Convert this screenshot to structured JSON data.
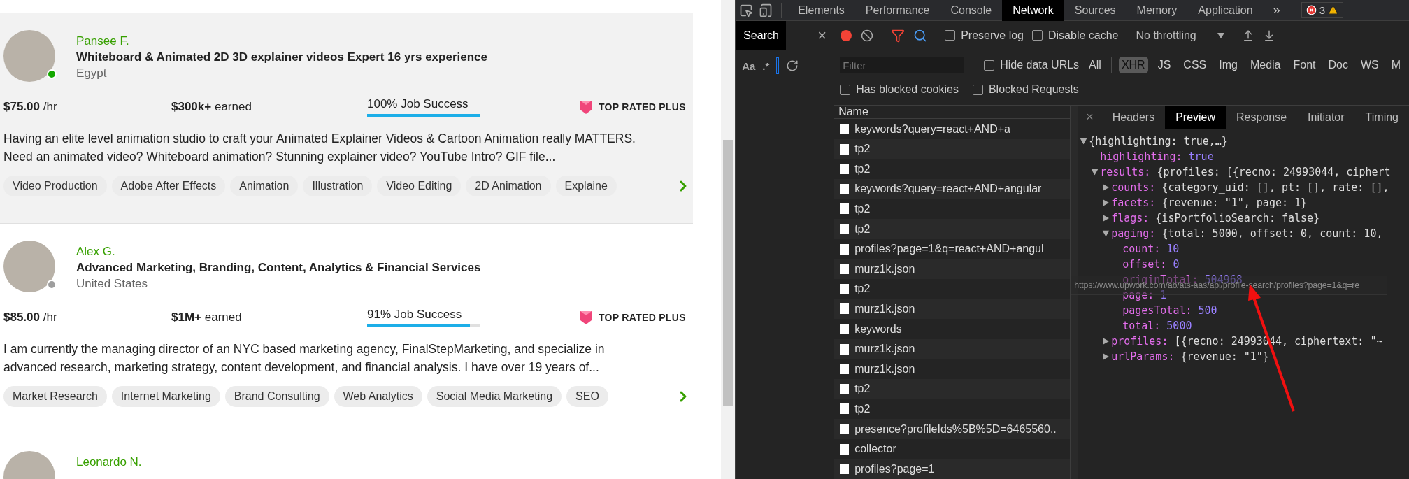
{
  "profiles": [
    {
      "name": "Pansee F.",
      "title": "Whiteboard & Animated 2D 3D explainer videos Expert 16 yrs experience",
      "country": "Egypt",
      "online": true,
      "highlighted": true,
      "rate": "$75.00",
      "rate_unit": "/hr",
      "earned": "$300k+",
      "earned_label": "earned",
      "job_success": "100% Job Success",
      "level": 1,
      "badge": "TOP RATED PLUS",
      "description": "Having an elite level animation studio to craft your Animated Explainer Videos & Cartoon Animation really MATTERS. Need an animated video? Whiteboard animation? Stunning explainer video? YouTube Intro? GIF file...",
      "skills": [
        "Video Production",
        "Adobe After Effects",
        "Animation",
        "Illustration",
        "Video Editing",
        "2D Animation",
        "Explaine"
      ]
    },
    {
      "name": "Alex G.",
      "title": "Advanced Marketing, Branding, Content, Analytics & Financial Services",
      "country": "United States",
      "online": false,
      "highlighted": false,
      "rate": "$85.00",
      "rate_unit": "/hr",
      "earned": "$1M+",
      "earned_label": "earned",
      "job_success": "91% Job Success",
      "level": 0.91,
      "badge": "TOP RATED PLUS",
      "description": "I am currently the managing director of an NYC based marketing agency, FinalStepMarketing, and specialize in advanced research, marketing strategy, content development, and financial analysis. I have over 19 years of...",
      "skills": [
        "Market Research",
        "Internet Marketing",
        "Brand Consulting",
        "Web Analytics",
        "Social Media Marketing",
        "SEO"
      ]
    },
    {
      "name": "Leonardo N.",
      "highlighted": false
    }
  ],
  "devtools": {
    "tabs": [
      {
        "label": "Elements",
        "selected": false
      },
      {
        "label": "Performance",
        "selected": false
      },
      {
        "label": "Console",
        "selected": false
      },
      {
        "label": "Network",
        "selected": true
      },
      {
        "label": "Sources",
        "selected": false
      },
      {
        "label": "Memory",
        "selected": false
      },
      {
        "label": "Application",
        "selected": false
      }
    ],
    "more": "»",
    "errors": "3",
    "search_panel": {
      "title": "Search",
      "close": "×",
      "case": "Aa",
      "regex": ".*"
    },
    "toolbar": {
      "preserve_log": {
        "label": "Preserve log",
        "checked": false
      },
      "disable_cache": {
        "label": "Disable cache",
        "checked": false
      },
      "throttling": "No throttling"
    },
    "filter": {
      "placeholder": "Filter",
      "hide_data_urls": {
        "label": "Hide data URLs",
        "checked": false
      },
      "types": [
        {
          "label": "All",
          "selected": false
        },
        {
          "label": "XHR",
          "selected": true
        },
        {
          "label": "JS",
          "selected": false
        },
        {
          "label": "CSS",
          "selected": false
        },
        {
          "label": "Img",
          "selected": false
        },
        {
          "label": "Media",
          "selected": false
        },
        {
          "label": "Font",
          "selected": false
        },
        {
          "label": "Doc",
          "selected": false
        },
        {
          "label": "WS",
          "selected": false
        },
        {
          "label": "M",
          "selected": false
        }
      ]
    },
    "blocked_cookies": {
      "label": "Has blocked cookies",
      "checked": false
    },
    "blocked_requests": {
      "label": "Blocked Requests",
      "checked": false
    },
    "requests": {
      "column": "Name",
      "rows": [
        "keywords?query=react+AND+a",
        "tp2",
        "tp2",
        "keywords?query=react+AND+angular",
        "tp2",
        "tp2",
        "profiles?page=1&q=react+AND+angul",
        "murz1k.json",
        "tp2",
        "murz1k.json",
        "keywords",
        "murz1k.json",
        "murz1k.json",
        "tp2",
        "tp2",
        "presence?profileIds%5B%5D=6465560..",
        "collector",
        "profiles?page=1"
      ]
    },
    "detail_tabs": {
      "close": "×",
      "tabs": [
        {
          "label": "Headers",
          "selected": false
        },
        {
          "label": "Preview",
          "selected": true
        },
        {
          "label": "Response",
          "selected": false
        },
        {
          "label": "Initiator",
          "selected": false
        },
        {
          "label": "Timing",
          "selected": false
        }
      ]
    },
    "preview": [
      {
        "value": "{highlighting: true,…}",
        "kind": "object",
        "expanded": true,
        "children": [
          {
            "key": "highlighting:",
            "value": "true",
            "kind": "literal"
          },
          {
            "key": "results:",
            "value": "{profiles: [{recno: 24993044, ciphert",
            "kind": "object",
            "expanded": true,
            "children": [
              {
                "key": "counts:",
                "value": "{category_uid: [], pt: [], rate: [],",
                "kind": "object",
                "expanded": false
              },
              {
                "key": "facets:",
                "value": "{revenue: \"1\", page: 1}",
                "kind": "object",
                "expanded": false
              },
              {
                "key": "flags:",
                "value": "{isPortfolioSearch: false}",
                "kind": "object",
                "expanded": false
              },
              {
                "key": "paging:",
                "value": "{total: 5000, offset: 0, count: 10,",
                "kind": "object",
                "expanded": true,
                "children": [
                  {
                    "key": "count:",
                    "value": "10",
                    "kind": "literal"
                  },
                  {
                    "key": "offset:",
                    "value": "0",
                    "kind": "literal"
                  },
                  {
                    "key": "originTotal:",
                    "value": "504968",
                    "kind": "literal"
                  },
                  {
                    "key": "page:",
                    "value": "1",
                    "kind": "literal"
                  },
                  {
                    "key": "pagesTotal:",
                    "value": "500",
                    "kind": "literal"
                  },
                  {
                    "key": "total:",
                    "value": "5000",
                    "kind": "literal"
                  }
                ]
              },
              {
                "key": "profiles:",
                "value": "[{recno: 24993044, ciphertext: \"~",
                "kind": "object",
                "expanded": false
              },
              {
                "key": "urlParams:",
                "value": "{revenue: \"1\"}",
                "kind": "object",
                "expanded": false
              }
            ]
          }
        ]
      }
    ],
    "tooltip": "https://www.upwork.com/ab/ats-aas/api/profile-search/profiles?page=1&q=re"
  }
}
